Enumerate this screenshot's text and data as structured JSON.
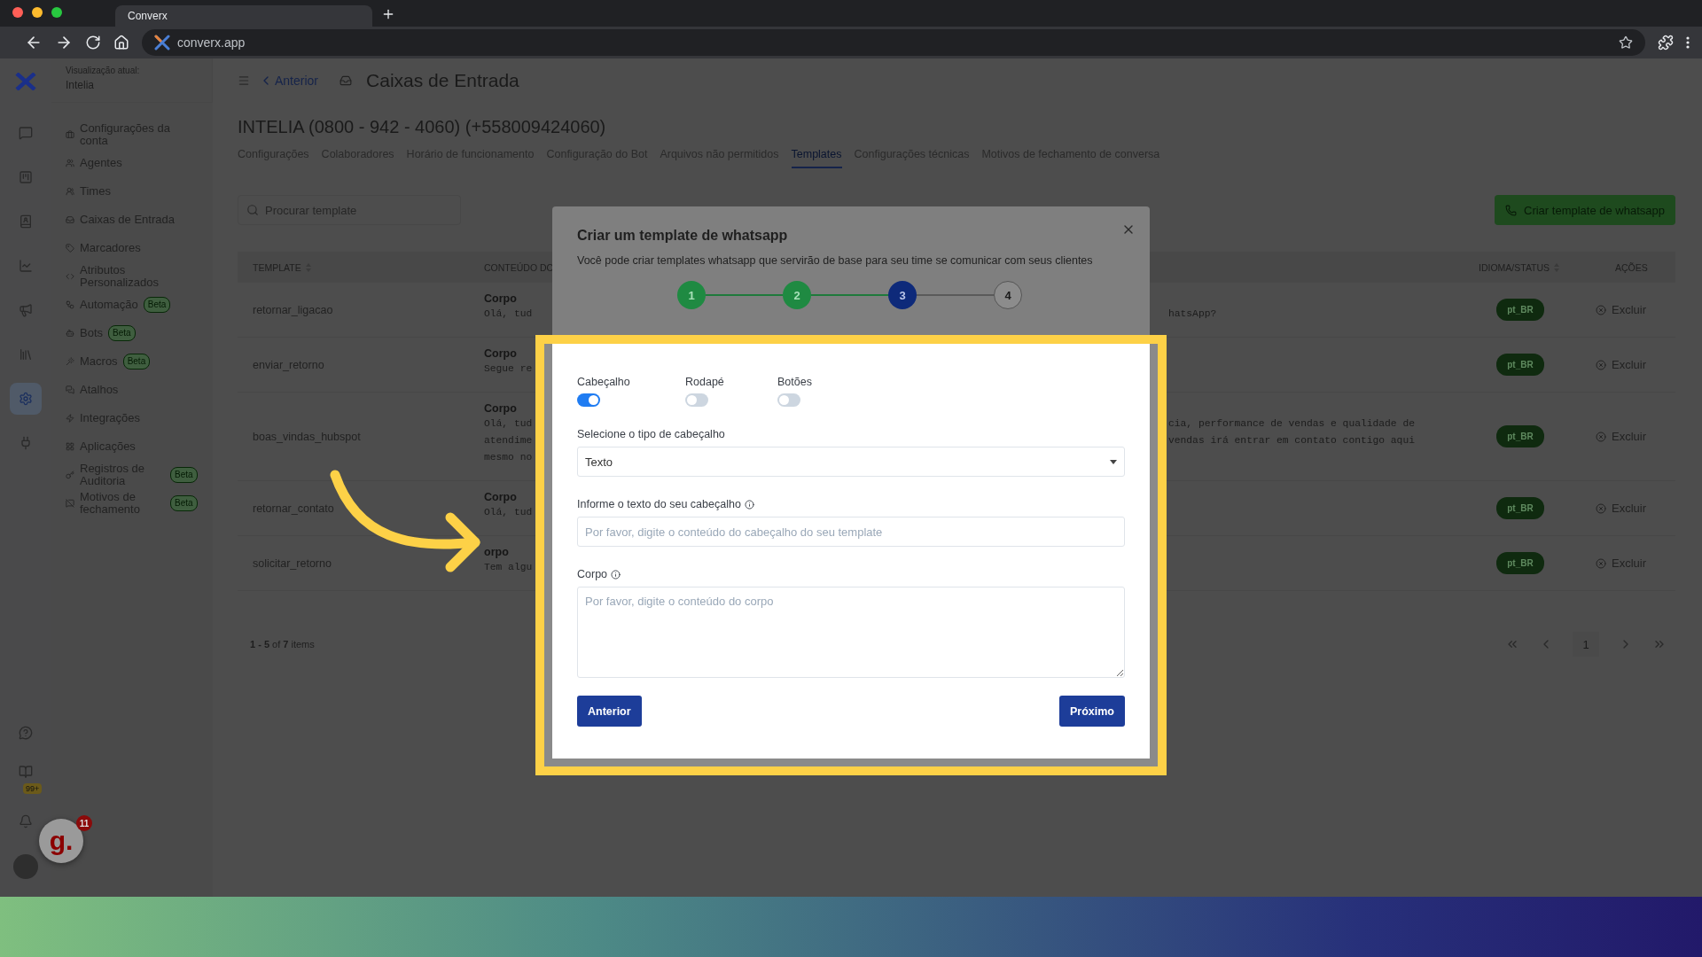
{
  "browser": {
    "tab_title": "Converx",
    "url": "converx.app"
  },
  "rail": {
    "items": [
      {
        "kind": "chat",
        "selected": false
      },
      {
        "kind": "board",
        "selected": false
      },
      {
        "kind": "contacts",
        "selected": false
      },
      {
        "kind": "reports",
        "selected": false
      },
      {
        "kind": "campaigns",
        "selected": false
      },
      {
        "kind": "library",
        "selected": false
      },
      {
        "kind": "settings",
        "selected": true
      },
      {
        "kind": "integrations",
        "selected": false
      }
    ],
    "bell_badge": "99+"
  },
  "widget": {
    "logo_text": "g.",
    "count": "11"
  },
  "account": {
    "label": "Visualização atual:",
    "name": "Intelia"
  },
  "sidebar": {
    "items": [
      {
        "kind": "account",
        "label": "Configurações da conta"
      },
      {
        "kind": "agents",
        "label": "Agentes"
      },
      {
        "kind": "teams",
        "label": "Times"
      },
      {
        "kind": "inboxes",
        "label": "Caixas de Entrada"
      },
      {
        "kind": "labels",
        "label": "Marcadores"
      },
      {
        "kind": "attributes",
        "label": "Atributos Personalizados"
      },
      {
        "kind": "automation",
        "label": "Automação",
        "badge": "Beta"
      },
      {
        "kind": "bots",
        "label": "Bots",
        "badge": "Beta"
      },
      {
        "kind": "macros",
        "label": "Macros",
        "badge": "Beta"
      },
      {
        "kind": "shortcuts",
        "label": "Atalhos"
      },
      {
        "kind": "integrations",
        "label": "Integrações"
      },
      {
        "kind": "apps",
        "label": "Aplicações"
      },
      {
        "kind": "audit",
        "label": "Registros de Auditoria",
        "badge": "Beta"
      },
      {
        "kind": "closing",
        "label": "Motivos de fechamento",
        "badge": "Beta"
      }
    ]
  },
  "header": {
    "back": "Anterior",
    "title": "Caixas de Entrada"
  },
  "inbox_title": "INTELIA (0800 - 942 - 4060) (+558009424060)",
  "tabs": [
    {
      "label": "Configurações",
      "selected": false
    },
    {
      "label": "Colaboradores",
      "selected": false
    },
    {
      "label": "Horário de funcionamento",
      "selected": false
    },
    {
      "label": "Configuração do Bot",
      "selected": false
    },
    {
      "label": "Arquivos não permitidos",
      "selected": false
    },
    {
      "label": "Templates",
      "selected": true
    },
    {
      "label": "Configurações técnicas",
      "selected": false
    },
    {
      "label": "Motivos de fechamento de conversa",
      "selected": false
    }
  ],
  "search": {
    "placeholder": "Procurar template"
  },
  "create_button": "Criar template de whatsapp",
  "table": {
    "columns": [
      "TEMPLATE",
      "CONTEÚDO DO",
      "IDIOMA/STATUS",
      "AÇÕES"
    ],
    "rows": [
      {
        "template": "retornar_ligacao",
        "content_heading": "Corpo",
        "content_left": [
          "Olá, tud"
        ],
        "content_right": [
          "hatsApp?"
        ],
        "language": "pt_BR",
        "action": "Excluir"
      },
      {
        "template": "enviar_retorno",
        "content_heading": "Corpo",
        "content_left": [
          "Segue re"
        ],
        "content_right": [],
        "language": "pt_BR",
        "action": "Excluir"
      },
      {
        "template": "boas_vindas_hubspot",
        "content_heading": "Corpo",
        "content_left": [
          "Olá, tud",
          "atendime",
          "mesmo no"
        ],
        "content_right": [
          "cia, performance de vendas e qualidade de",
          "vendas irá entrar em contato contigo aqui"
        ],
        "language": "pt_BR",
        "action": "Excluir"
      },
      {
        "template": "retornar_contato",
        "content_heading": "Corpo",
        "content_left": [
          "Olá, tud"
        ],
        "content_right": [],
        "language": "pt_BR",
        "action": "Excluir"
      },
      {
        "template": "solicitar_retorno",
        "content_heading": "orpo",
        "content_left": [
          "Tem algu"
        ],
        "content_right": [],
        "language": "pt_BR",
        "action": "Excluir"
      }
    ]
  },
  "pagination": {
    "summary": "**1 - 5** of **7** items",
    "page": "1"
  },
  "modal": {
    "title": "Criar um template de whatsapp",
    "description": "Você pode criar templates whatsapp que servirão de base para seu time se comunicar com seus clientes",
    "steps": [
      {
        "label": "1",
        "done": true,
        "current": false
      },
      {
        "label": "2",
        "done": true,
        "current": false
      },
      {
        "label": "3",
        "done": false,
        "current": true
      },
      {
        "label": "4",
        "done": false,
        "current": false
      }
    ],
    "toggles": [
      {
        "label": "Cabeçalho",
        "on": true
      },
      {
        "label": "Rodapé",
        "on": false
      },
      {
        "label": "Botões",
        "on": false
      }
    ],
    "header_type": {
      "label": "Selecione o tipo de cabeçalho",
      "value": "Texto"
    },
    "header_text": {
      "label": "Informe o texto do seu cabeçalho",
      "placeholder": "Por favor, digite o conteúdo do cabeçalho do seu template"
    },
    "body": {
      "label": "Corpo",
      "placeholder": "Por favor, digite o conteúdo do corpo"
    },
    "back_button": "Anterior",
    "next_button": "Próximo"
  }
}
